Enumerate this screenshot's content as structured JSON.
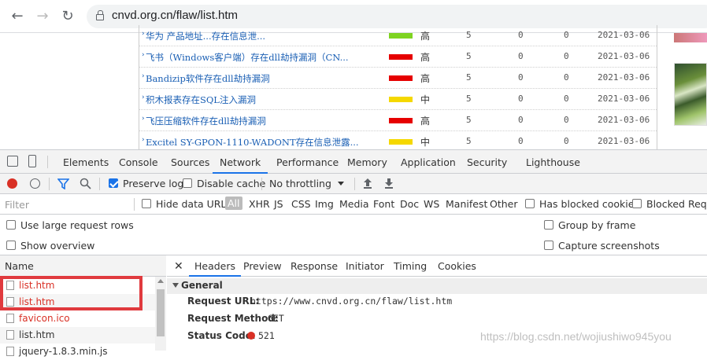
{
  "browser": {
    "back_icon": "←",
    "forward_icon": "→",
    "reload_icon": "↻",
    "url": "cnvd.org.cn/flaw/list.htm"
  },
  "vuln_list": {
    "rows": [
      {
        "name": "华为 产品地址...存在信息泄...",
        "level": "高",
        "bar_color": "#7ed321",
        "c1": "5",
        "c2": "0",
        "c3": "0",
        "date": "2021-03-06"
      },
      {
        "name": "飞书（Windows客户端）存在dll劫持漏洞（CN...",
        "level": "高",
        "bar_color": "#e60000",
        "c1": "5",
        "c2": "0",
        "c3": "0",
        "date": "2021-03-06"
      },
      {
        "name": "Bandizip软件存在dll劫持漏洞",
        "level": "高",
        "bar_color": "#e60000",
        "c1": "5",
        "c2": "0",
        "c3": "0",
        "date": "2021-03-06"
      },
      {
        "name": "积木报表存在SQL注入漏洞",
        "level": "中",
        "bar_color": "#f5d800",
        "c1": "5",
        "c2": "0",
        "c3": "0",
        "date": "2021-03-06"
      },
      {
        "name": "飞压压缩软件存在dll劫持漏洞",
        "level": "高",
        "bar_color": "#e60000",
        "c1": "5",
        "c2": "0",
        "c3": "0",
        "date": "2021-03-06"
      },
      {
        "name": "Excitel SY-GPON-1110-WADONT存在信息泄露...",
        "level": "中",
        "bar_color": "#f5d800",
        "c1": "5",
        "c2": "0",
        "c3": "0",
        "date": "2021-03-06"
      }
    ]
  },
  "devtools": {
    "tabs": [
      "Elements",
      "Console",
      "Sources",
      "Network",
      "Performance",
      "Memory",
      "Application",
      "Security",
      "Lighthouse"
    ],
    "active_tab": "Network",
    "toolbar": {
      "preserve_log": "Preserve log",
      "disable_cache": "Disable cache",
      "throttling": "No throttling"
    },
    "filter": {
      "placeholder": "Filter",
      "hide_data_urls": "Hide data URLs",
      "types": [
        "All",
        "XHR",
        "JS",
        "CSS",
        "Img",
        "Media",
        "Font",
        "Doc",
        "WS",
        "Manifest",
        "Other"
      ],
      "has_blocked_cookies": "Has blocked cookies",
      "blocked_requests": "Blocked Reque"
    },
    "options": {
      "large_rows": "Use large request rows",
      "show_overview": "Show overview",
      "group_by_frame": "Group by frame",
      "capture_screenshots": "Capture screenshots"
    },
    "name_header": "Name",
    "requests": [
      {
        "name": "list.htm",
        "color": "#d93025"
      },
      {
        "name": "list.htm",
        "color": "#d93025"
      },
      {
        "name": "favicon.ico",
        "color": "#d93025"
      },
      {
        "name": "list.htm",
        "color": "#333333"
      },
      {
        "name": "jquery-1.8.3.min.js",
        "color": "#333333"
      }
    ],
    "detail_tabs": [
      "Headers",
      "Preview",
      "Response",
      "Initiator",
      "Timing",
      "Cookies"
    ],
    "active_detail_tab": "Headers",
    "general_title": "General",
    "general": {
      "request_url_label": "Request URL:",
      "request_url": "https://www.cnvd.org.cn/flaw/list.htm",
      "request_method_label": "Request Method:",
      "request_method": "GET",
      "status_code_label": "Status Code:",
      "status_code": "521"
    }
  },
  "watermark": "https://blog.csdn.net/wojiushiwo945you"
}
